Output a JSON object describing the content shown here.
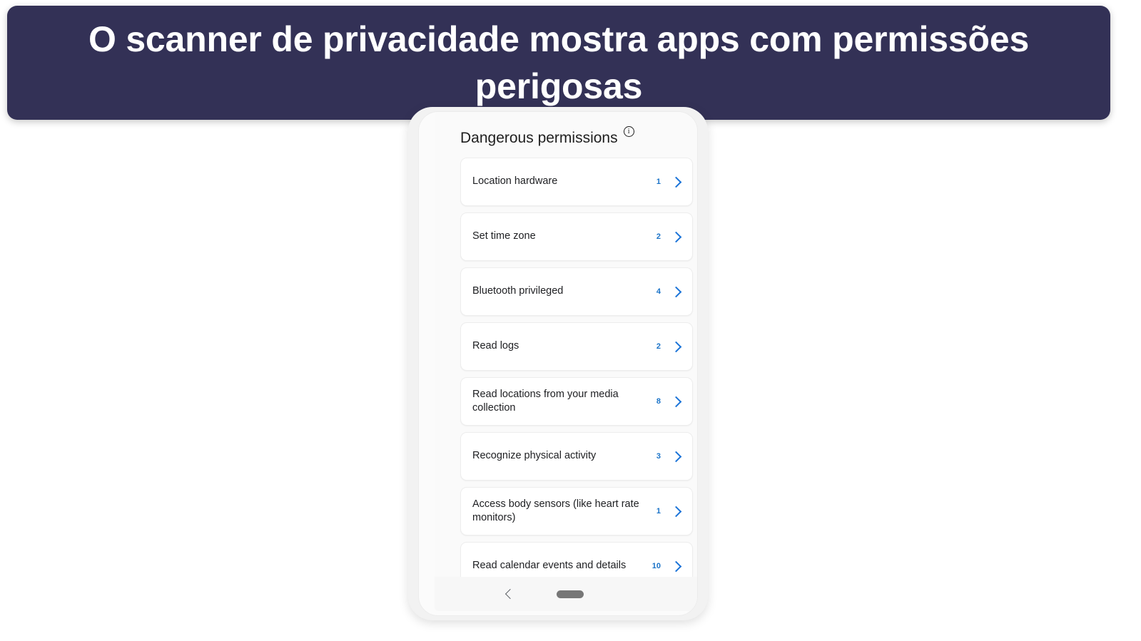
{
  "banner": {
    "text": "O scanner de privacidade mostra apps com permissões perigosas",
    "background": "#333156",
    "text_color": "#ffffff"
  },
  "phone": {
    "screen": {
      "section": {
        "title": "Dangerous permissions",
        "info_icon": "info-circle-icon"
      },
      "permissions": [
        {
          "label": "Location hardware",
          "count": "1"
        },
        {
          "label": "Set time zone",
          "count": "2"
        },
        {
          "label": "Bluetooth privileged",
          "count": "4"
        },
        {
          "label": "Read logs",
          "count": "2"
        },
        {
          "label": "Read locations from your media collection",
          "count": "8"
        },
        {
          "label": "Recognize physical activity",
          "count": "3"
        },
        {
          "label": "Access body sensors (like heart rate monitors)",
          "count": "1"
        },
        {
          "label": "Read calendar events and details",
          "count": "10"
        }
      ],
      "accent_color": "#1a73d8",
      "nav": {
        "back_icon": "chevron-left-icon",
        "home_indicator": "home-pill-icon"
      }
    }
  }
}
